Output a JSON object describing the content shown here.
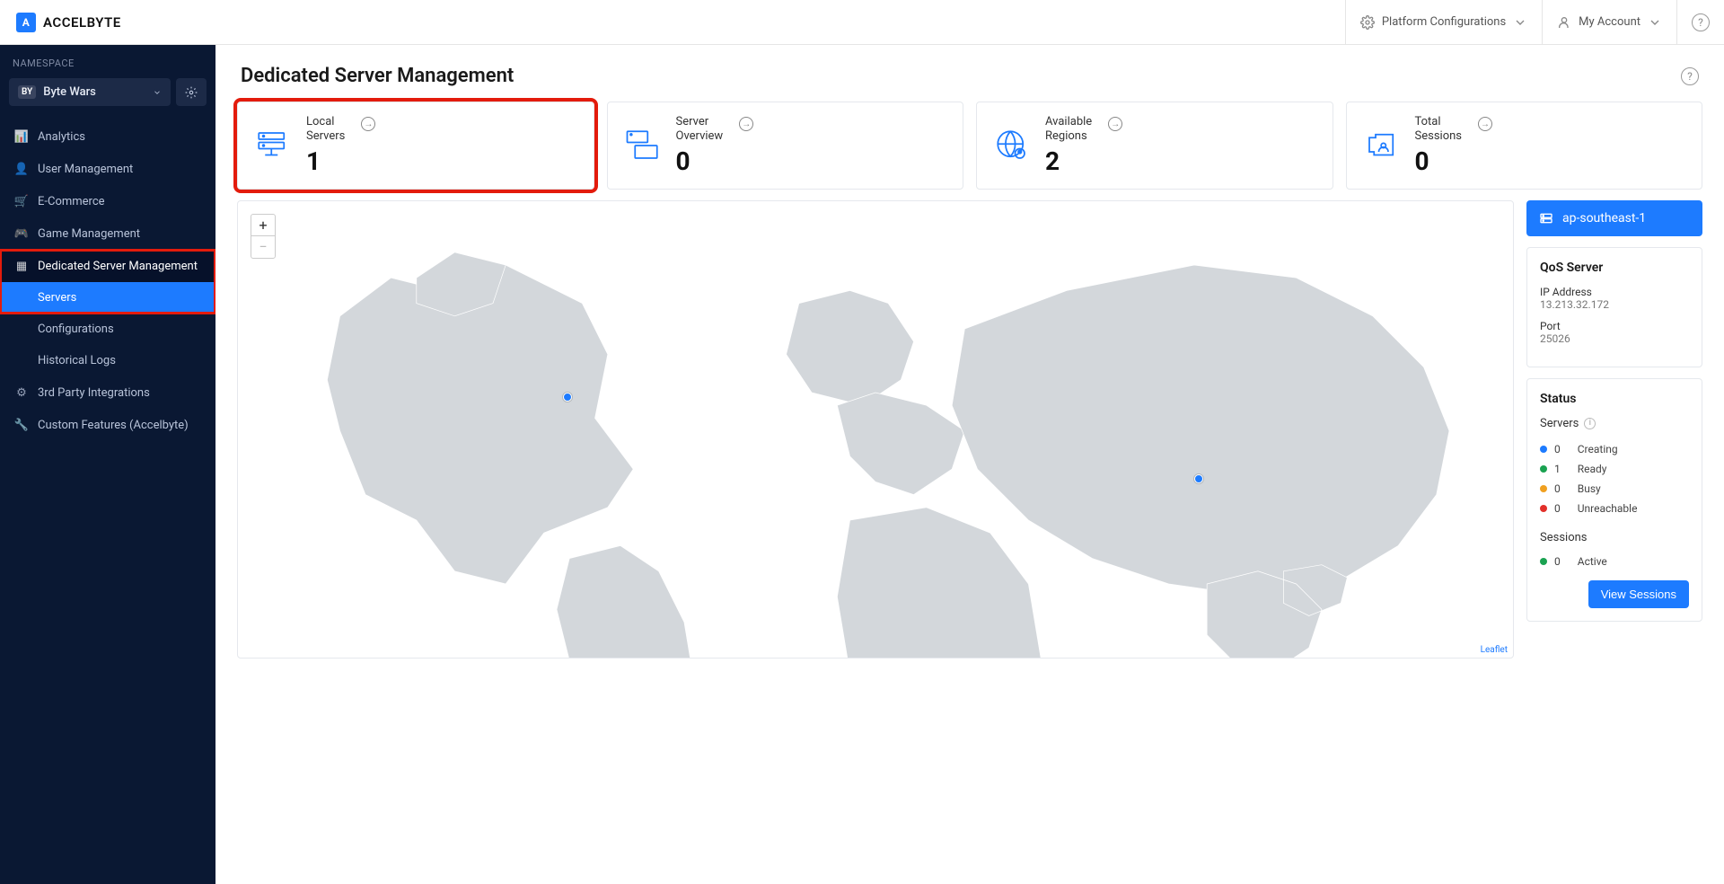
{
  "topbar": {
    "brand": "ACCELBYTE",
    "platform_config": "Platform Configurations",
    "my_account": "My Account"
  },
  "sidebar": {
    "namespace_label": "NAMESPACE",
    "namespace_badge": "BY",
    "namespace_name": "Byte Wars",
    "items": [
      {
        "label": "Analytics"
      },
      {
        "label": "User Management"
      },
      {
        "label": "E-Commerce"
      },
      {
        "label": "Game Management"
      },
      {
        "label": "Dedicated Server Management",
        "active": true,
        "children": [
          {
            "label": "Servers",
            "active": true
          },
          {
            "label": "Configurations"
          },
          {
            "label": "Historical Logs"
          }
        ]
      },
      {
        "label": "3rd Party Integrations"
      },
      {
        "label": "Custom Features (Accelbyte)"
      }
    ]
  },
  "page": {
    "title": "Dedicated Server Management"
  },
  "cards": [
    {
      "label_line1": "Local",
      "label_line2": "Servers",
      "value": "1",
      "highlighted": true
    },
    {
      "label_line1": "Server",
      "label_line2": "Overview",
      "value": "0"
    },
    {
      "label_line1": "Available",
      "label_line2": "Regions",
      "value": "2"
    },
    {
      "label_line1": "Total",
      "label_line2": "Sessions",
      "value": "0"
    }
  ],
  "map": {
    "zoom_in": "+",
    "zoom_out": "−",
    "attribution": "Leaflet"
  },
  "region": {
    "selected": "ap-southeast-1"
  },
  "qos": {
    "title": "QoS Server",
    "ip_label": "IP Address",
    "ip_value": "13.213.32.172",
    "port_label": "Port",
    "port_value": "25026"
  },
  "status": {
    "title": "Status",
    "servers_label": "Servers",
    "servers": [
      {
        "count": "0",
        "label": "Creating",
        "color": "blue"
      },
      {
        "count": "1",
        "label": "Ready",
        "color": "green"
      },
      {
        "count": "0",
        "label": "Busy",
        "color": "orange"
      },
      {
        "count": "0",
        "label": "Unreachable",
        "color": "red"
      }
    ],
    "sessions_label": "Sessions",
    "sessions": [
      {
        "count": "0",
        "label": "Active",
        "color": "green"
      }
    ],
    "view_sessions": "View Sessions"
  }
}
